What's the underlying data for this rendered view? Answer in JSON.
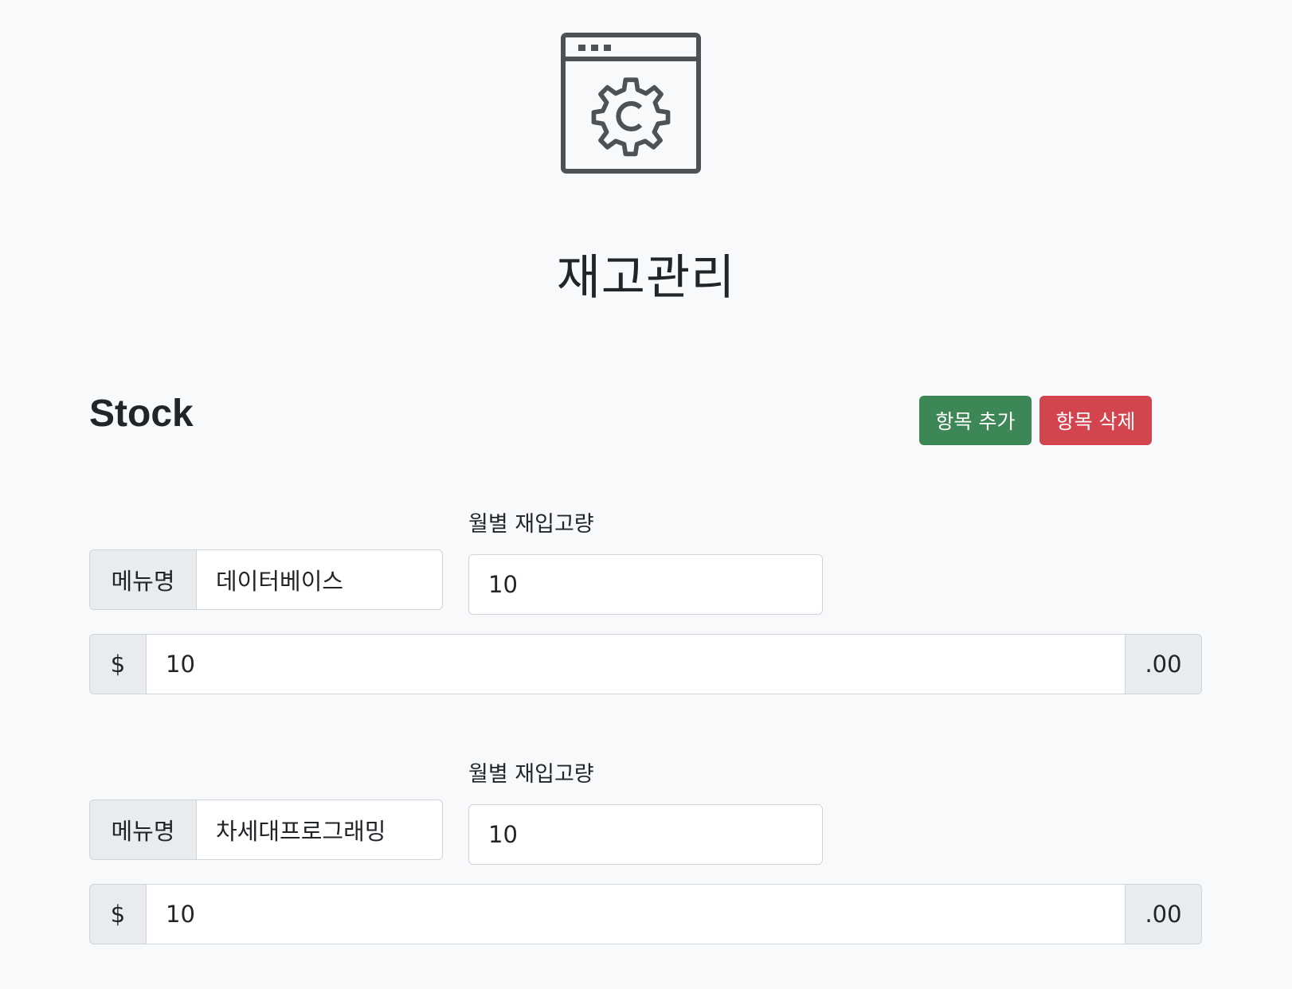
{
  "app": {
    "title": "재고관리",
    "logo_icon": "settings-window-icon"
  },
  "section": {
    "title": "Stock"
  },
  "actions": {
    "add_label": "항목 추가",
    "delete_label": "항목 삭제",
    "add_color": "#3d8756",
    "delete_color": "#d2454f"
  },
  "entries": [
    {
      "menu_label": "메뉴명",
      "menu_value": "데이터베이스",
      "qty_label": "월별 재입고량",
      "qty_value": "10",
      "currency_symbol": "$",
      "price_value": "10",
      "price_suffix": ".00"
    },
    {
      "menu_label": "메뉴명",
      "menu_value": "차세대프로그래밍",
      "qty_label": "월별 재입고량",
      "qty_value": "10",
      "currency_symbol": "$",
      "price_value": "10",
      "price_suffix": ".00"
    }
  ]
}
